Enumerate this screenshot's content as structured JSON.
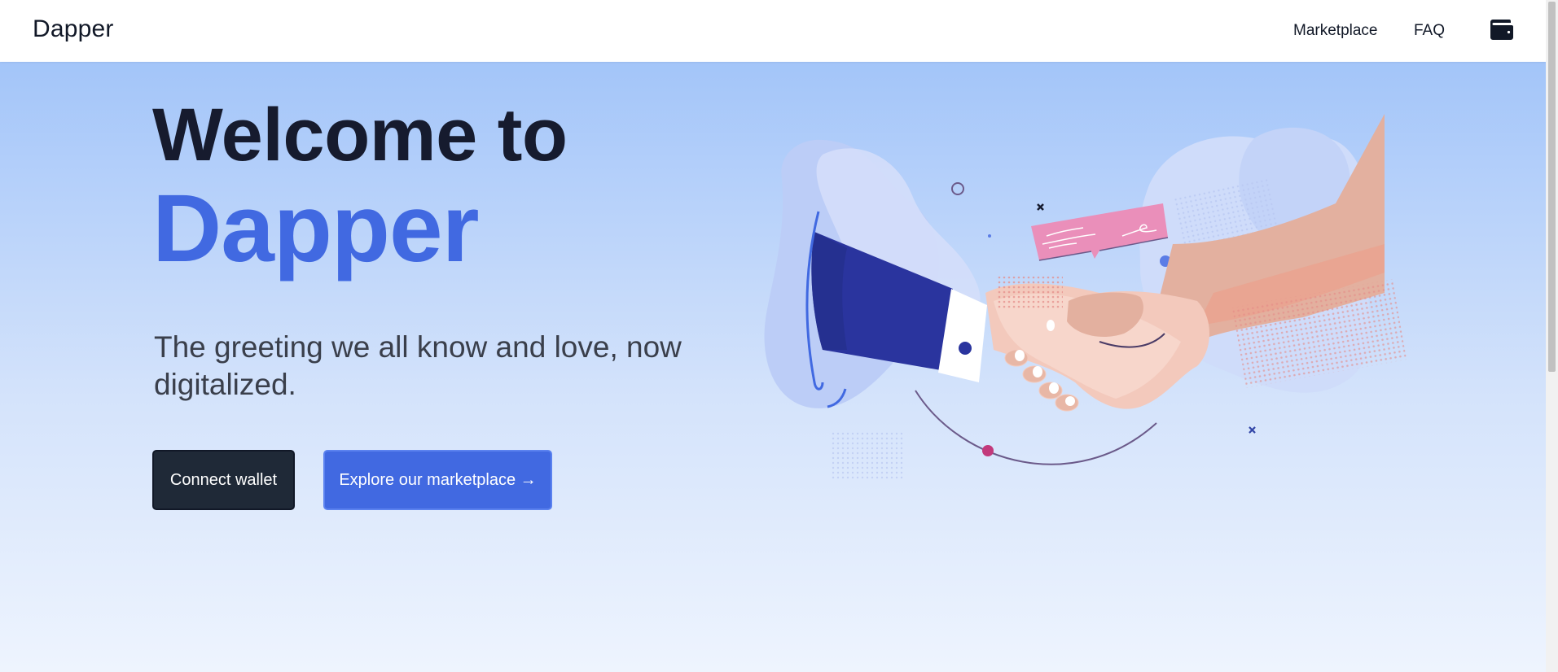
{
  "navbar": {
    "brand": "Dapper",
    "links": [
      "Marketplace",
      "FAQ"
    ],
    "wallet_icon": "wallet-icon"
  },
  "hero": {
    "title_line1": "Welcome to",
    "title_line2": "Dapper",
    "subtitle": "The greeting we all know and love, now digitalized.",
    "buttons": {
      "connect": "Connect wallet",
      "explore": "Explore our marketplace →"
    },
    "illustration": "handshake-illustration"
  },
  "colors": {
    "accent": "#4169e1",
    "dark_button": "#1f2937",
    "hero_top": "#a3c5f9",
    "hero_bottom": "#eef4fe",
    "title_dark": "#161b2e"
  }
}
